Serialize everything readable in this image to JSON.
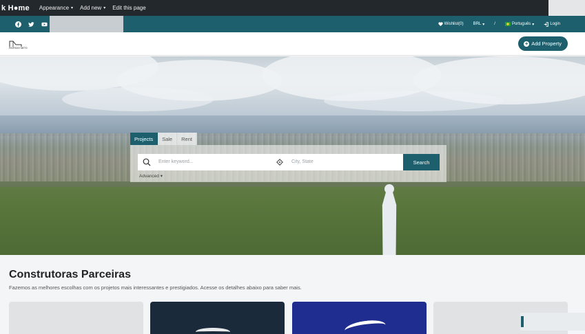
{
  "adminbar": {
    "brand": "k H●me",
    "menus": [
      {
        "label": "Appearance",
        "caret": "▾"
      },
      {
        "label": "Add new",
        "caret": "▾"
      },
      {
        "label": "Edit this page",
        "caret": ""
      }
    ]
  },
  "topbar": {
    "wishlist": "Wishlist(0)",
    "currency": "BRL",
    "separator": "/",
    "language": "Português",
    "login": "Login",
    "social_icons": [
      "facebook-icon",
      "twitter-icon",
      "youtube-icon"
    ]
  },
  "header": {
    "logo_text": "PATRICIO NETO",
    "add_property": "Add Property"
  },
  "search": {
    "tabs": [
      "Projects",
      "Sale",
      "Rent"
    ],
    "active_tab": "Projects",
    "keyword_placeholder": "Enter keyword...",
    "city_placeholder": "City, State",
    "button": "Search",
    "advanced": "Advanced"
  },
  "section": {
    "title": "Construtoras Parceiras",
    "subtitle": "Fazemos as melhores escolhas com os projetos mais interessantes e prestigiados. Acesse os detalhes abaixo para saber mais."
  },
  "colors": {
    "primary": "#1d5f6c",
    "adminbar": "#23282d"
  }
}
